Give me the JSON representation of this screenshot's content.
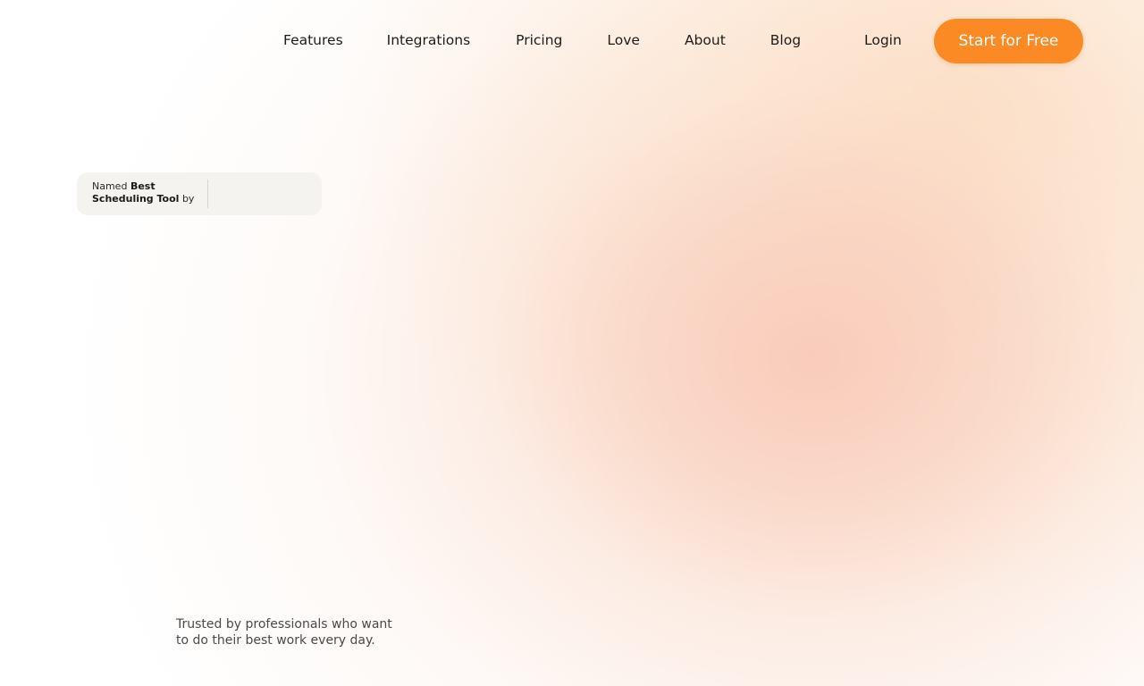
{
  "nav": {
    "links": [
      "Features",
      "Integrations",
      "Pricing",
      "Love",
      "About",
      "Blog"
    ],
    "login": "Login",
    "cta": "Start for Free"
  },
  "badge": {
    "prefix": "Named",
    "highlight": "Best Scheduling Tool",
    "suffix": "by"
  },
  "trusted": {
    "line1": "Trusted by professionals who want",
    "line2": "to do their best work every day."
  },
  "colors": {
    "accent": "#fc8a24",
    "badge_bg": "#f4f3ef",
    "glow": "#f8c4b2"
  }
}
